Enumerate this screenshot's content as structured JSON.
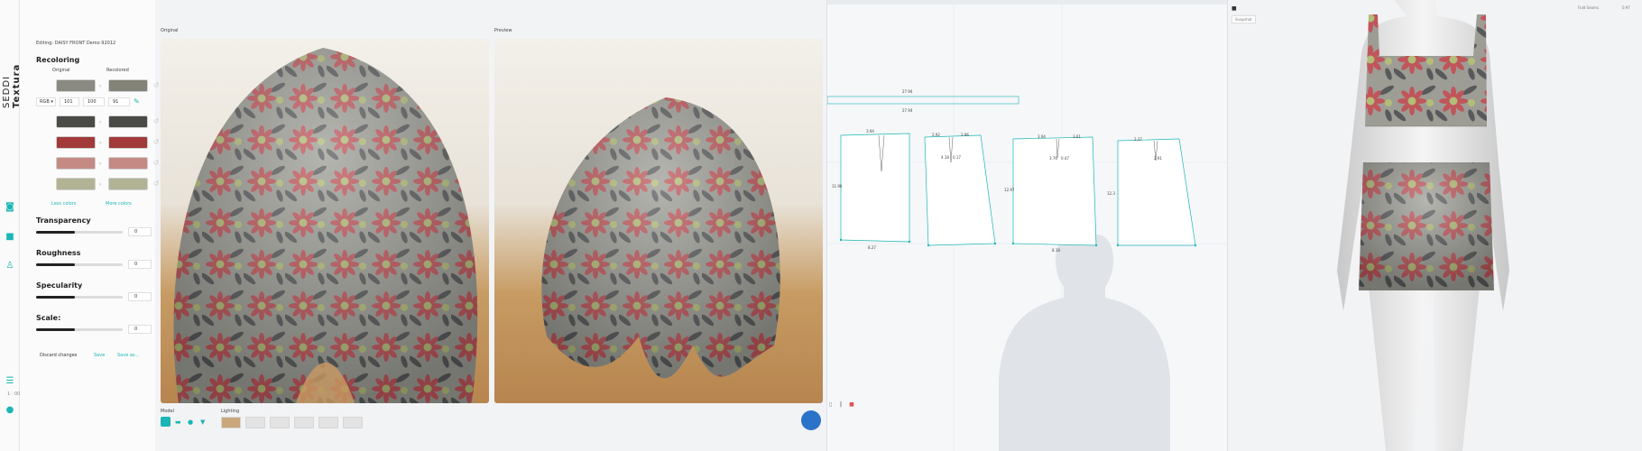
{
  "app": {
    "brand_prefix": "SEDDI",
    "brand_name": "Textura"
  },
  "panel": {
    "editing": "Editing: DAISY FRONT Demo 92012",
    "section_recoloring": "Recoloring",
    "col_original": "Original",
    "col_recolored": "Recolored",
    "color_mode": "RGB",
    "rgb_values": [
      "101",
      "100",
      "91"
    ],
    "swatches": [
      {
        "original": "#8a8a82",
        "recolored": "#838378"
      },
      {
        "original": "#4a4a46",
        "recolored": "#4a4a46"
      },
      {
        "original": "#a23a3a",
        "recolored": "#a23a3a"
      },
      {
        "original": "#c58a84",
        "recolored": "#c58a84"
      },
      {
        "original": "#b2b394",
        "recolored": "#b2b394"
      }
    ],
    "less_colors": "Less colors",
    "more_colors": "More colors",
    "sliders": [
      {
        "label": "Transparency",
        "value": "0",
        "level": 0.45
      },
      {
        "label": "Roughness",
        "value": "0",
        "level": 0.45
      },
      {
        "label": "Specularity",
        "value": "0",
        "level": 0.45
      },
      {
        "label": "Scale:",
        "value": "0",
        "level": 0.45
      }
    ],
    "discard": "Discard changes",
    "save": "Save",
    "save_as": "Save as..."
  },
  "views": {
    "original_label": "Original",
    "preview_label": "Preview",
    "model_label": "Model",
    "lighting_label": "Lighting"
  },
  "pattern": {
    "measurements": [
      "27.94",
      "27.94",
      "3.94",
      "3.94",
      "2.92",
      "2.96",
      "4.18",
      "0.17",
      "11.96",
      "8.27",
      "3.94",
      "3.61",
      "3.76",
      "0.47",
      "12.97",
      "8.18",
      "3.37",
      "2.91",
      "12.3"
    ]
  },
  "avatar_panel": {
    "top_button": "Snapshot",
    "top_right": "Fold Seams",
    "top_right_value": "0.97"
  },
  "accent": "#1bb5b5",
  "fabric_colors": {
    "base": "#9d9d95",
    "red": "#c0555a",
    "dark": "#4c4d50",
    "green": "#b3bd77"
  }
}
